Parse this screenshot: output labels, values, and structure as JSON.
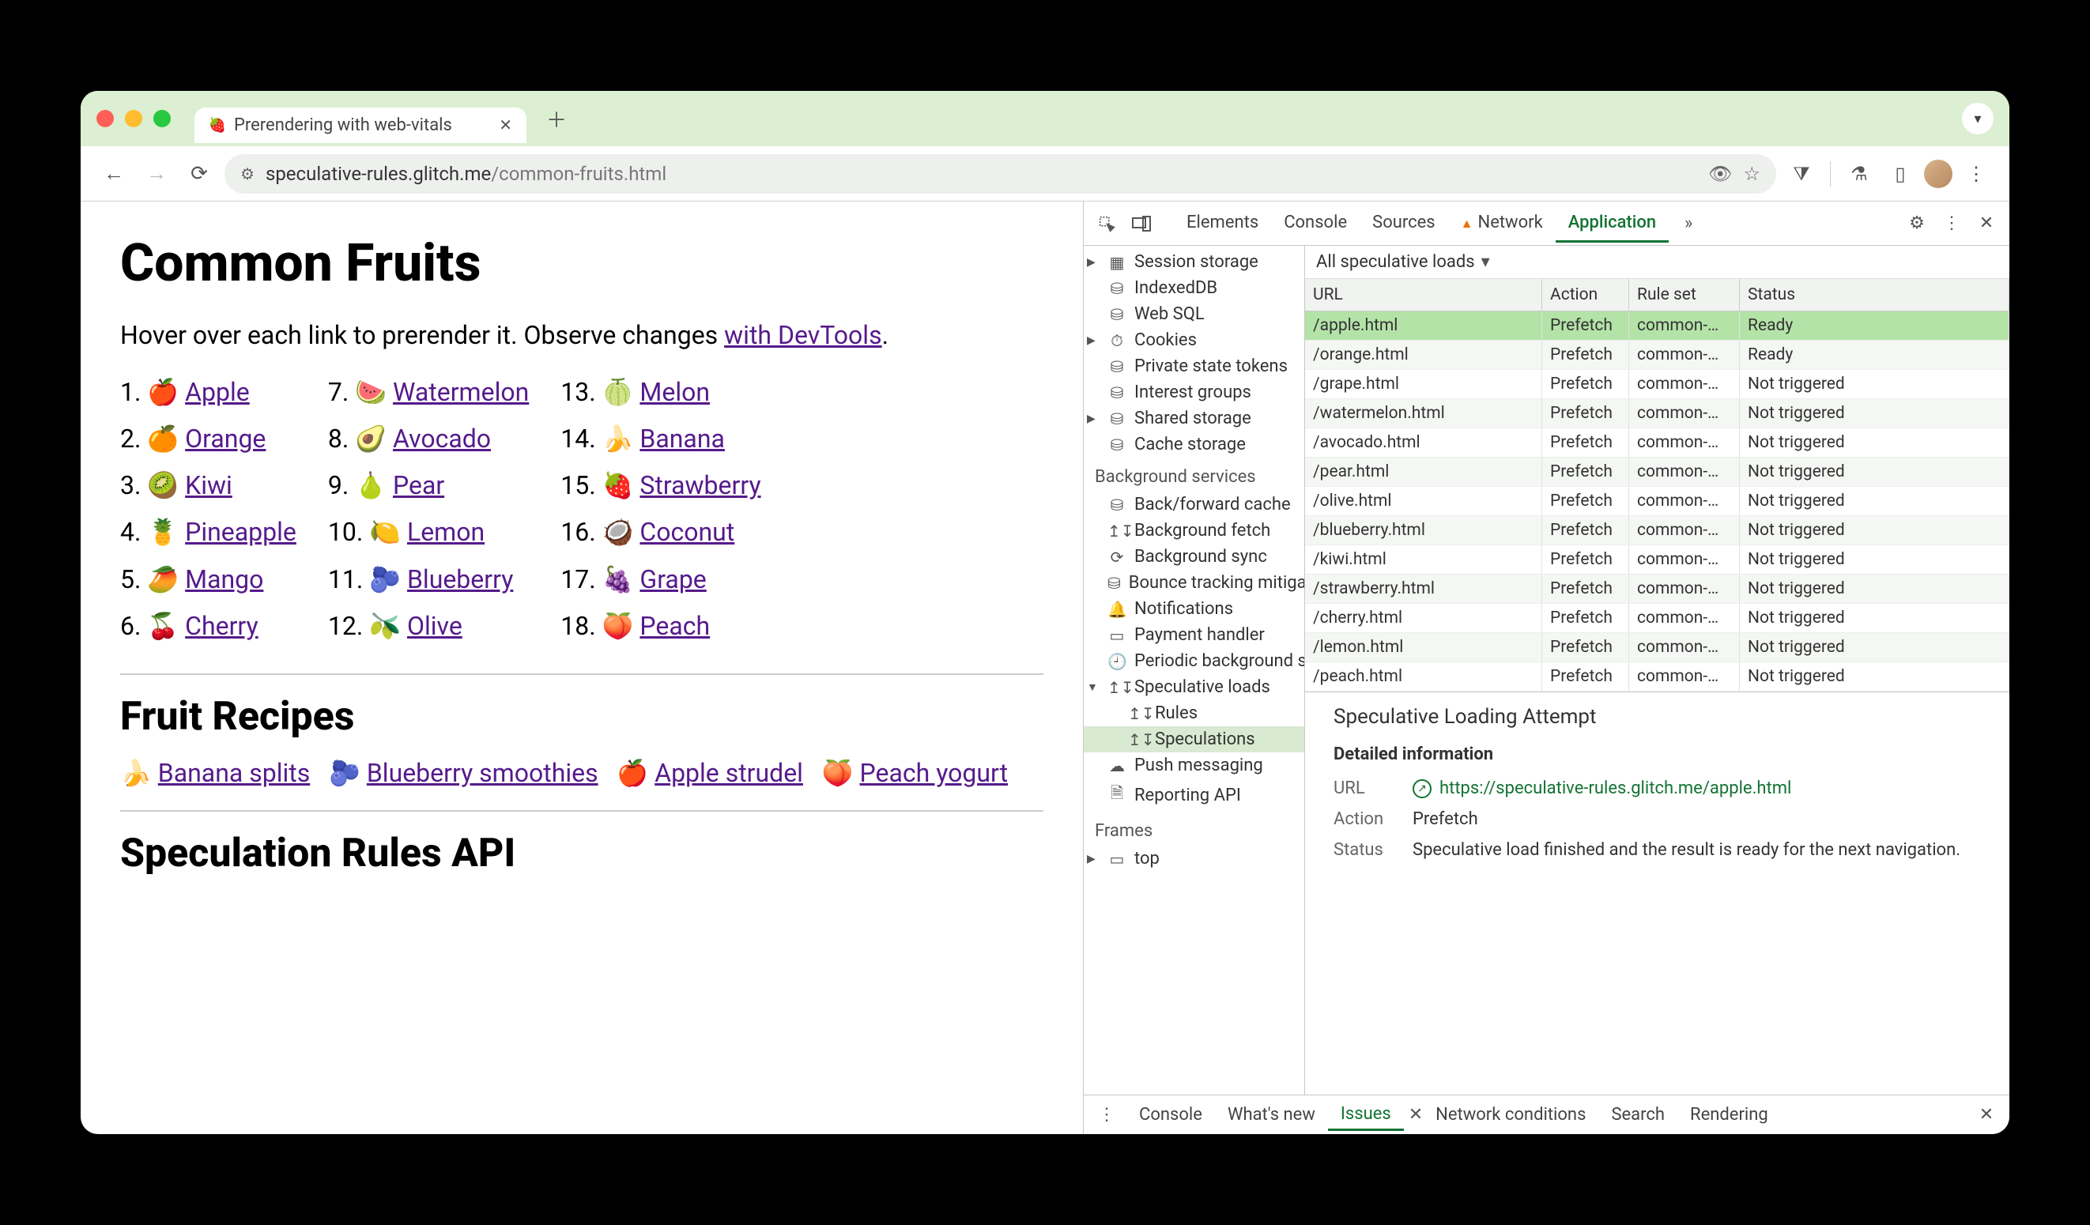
{
  "browser": {
    "tab_title": "Prerendering with web-vitals",
    "url_host": "speculative-rules.glitch.me",
    "url_path": "/common-fruits.html"
  },
  "page": {
    "h1": "Common Fruits",
    "intro_a": "Hover over each link to prerender it. Observe changes ",
    "intro_link": "with DevTools",
    "intro_b": ".",
    "fruits": [
      {
        "n": "1.",
        "e": "🍎",
        "t": "Apple"
      },
      {
        "n": "2.",
        "e": "🍊",
        "t": "Orange"
      },
      {
        "n": "3.",
        "e": "🥝",
        "t": "Kiwi"
      },
      {
        "n": "4.",
        "e": "🍍",
        "t": "Pineapple"
      },
      {
        "n": "5.",
        "e": "🥭",
        "t": "Mango"
      },
      {
        "n": "6.",
        "e": "🍒",
        "t": "Cherry"
      },
      {
        "n": "7.",
        "e": "🍉",
        "t": "Watermelon"
      },
      {
        "n": "8.",
        "e": "🥑",
        "t": "Avocado"
      },
      {
        "n": "9.",
        "e": "🍐",
        "t": "Pear"
      },
      {
        "n": "10.",
        "e": "🍋",
        "t": "Lemon"
      },
      {
        "n": "11.",
        "e": "🫐",
        "t": "Blueberry"
      },
      {
        "n": "12.",
        "e": "🫒",
        "t": "Olive"
      },
      {
        "n": "13.",
        "e": "🍈",
        "t": "Melon"
      },
      {
        "n": "14.",
        "e": "🍌",
        "t": "Banana"
      },
      {
        "n": "15.",
        "e": "🍓",
        "t": "Strawberry"
      },
      {
        "n": "16.",
        "e": "🥥",
        "t": "Coconut"
      },
      {
        "n": "17.",
        "e": "🍇",
        "t": "Grape"
      },
      {
        "n": "18.",
        "e": "🍑",
        "t": "Peach"
      }
    ],
    "h2_recipes": "Fruit Recipes",
    "recipes": [
      {
        "e": "🍌",
        "t": "Banana splits"
      },
      {
        "e": "🫐",
        "t": "Blueberry smoothies"
      },
      {
        "e": "🍎",
        "t": "Apple strudel"
      },
      {
        "e": "🍑",
        "t": "Peach yogurt"
      }
    ],
    "h2_spec": "Speculation Rules API"
  },
  "devtools": {
    "tabs": [
      "Elements",
      "Console",
      "Sources",
      "Network",
      "Application"
    ],
    "sidebar": {
      "storage": [
        {
          "i": "▦",
          "t": "Session storage",
          "tri": true
        },
        {
          "i": "⛁",
          "t": "IndexedDB"
        },
        {
          "i": "⛁",
          "t": "Web SQL"
        },
        {
          "i": "⏱",
          "t": "Cookies",
          "tri": true
        },
        {
          "i": "⛁",
          "t": "Private state tokens"
        },
        {
          "i": "⛁",
          "t": "Interest groups"
        },
        {
          "i": "⛁",
          "t": "Shared storage",
          "tri": true
        },
        {
          "i": "⛁",
          "t": "Cache storage"
        }
      ],
      "bg_label": "Background services",
      "bg": [
        {
          "i": "⛁",
          "t": "Back/forward cache"
        },
        {
          "i": "↥↧",
          "t": "Background fetch"
        },
        {
          "i": "⟳",
          "t": "Background sync"
        },
        {
          "i": "⛁",
          "t": "Bounce tracking mitigations"
        },
        {
          "i": "🔔",
          "t": "Notifications"
        },
        {
          "i": "▭",
          "t": "Payment handler"
        },
        {
          "i": "🕘",
          "t": "Periodic background sync"
        },
        {
          "i": "↥↧",
          "t": "Speculative loads",
          "tri": true,
          "open": true
        },
        {
          "i": "↥↧",
          "t": "Rules",
          "indent": true
        },
        {
          "i": "↥↧",
          "t": "Speculations",
          "indent": true,
          "selected": true
        },
        {
          "i": "☁",
          "t": "Push messaging"
        },
        {
          "i": "🗎",
          "t": "Reporting API"
        }
      ],
      "frames_label": "Frames",
      "frames": [
        {
          "i": "▭",
          "t": "top",
          "tri": true
        }
      ]
    },
    "filter": "All speculative loads",
    "columns": {
      "url": "URL",
      "action": "Action",
      "ruleset": "Rule set",
      "status": "Status"
    },
    "rows": [
      {
        "url": "/apple.html",
        "action": "Prefetch",
        "ruleset": "common-…",
        "status": "Ready",
        "sel": true
      },
      {
        "url": "/orange.html",
        "action": "Prefetch",
        "ruleset": "common-…",
        "status": "Ready"
      },
      {
        "url": "/grape.html",
        "action": "Prefetch",
        "ruleset": "common-…",
        "status": "Not triggered"
      },
      {
        "url": "/watermelon.html",
        "action": "Prefetch",
        "ruleset": "common-…",
        "status": "Not triggered"
      },
      {
        "url": "/avocado.html",
        "action": "Prefetch",
        "ruleset": "common-…",
        "status": "Not triggered"
      },
      {
        "url": "/pear.html",
        "action": "Prefetch",
        "ruleset": "common-…",
        "status": "Not triggered"
      },
      {
        "url": "/olive.html",
        "action": "Prefetch",
        "ruleset": "common-…",
        "status": "Not triggered"
      },
      {
        "url": "/blueberry.html",
        "action": "Prefetch",
        "ruleset": "common-…",
        "status": "Not triggered"
      },
      {
        "url": "/kiwi.html",
        "action": "Prefetch",
        "ruleset": "common-…",
        "status": "Not triggered"
      },
      {
        "url": "/strawberry.html",
        "action": "Prefetch",
        "ruleset": "common-…",
        "status": "Not triggered"
      },
      {
        "url": "/cherry.html",
        "action": "Prefetch",
        "ruleset": "common-…",
        "status": "Not triggered"
      },
      {
        "url": "/lemon.html",
        "action": "Prefetch",
        "ruleset": "common-…",
        "status": "Not triggered"
      },
      {
        "url": "/peach.html",
        "action": "Prefetch",
        "ruleset": "common-…",
        "status": "Not triggered"
      }
    ],
    "detail": {
      "title": "Speculative Loading Attempt",
      "subtitle": "Detailed information",
      "url_k": "URL",
      "url_v": "https://speculative-rules.glitch.me/apple.html",
      "action_k": "Action",
      "action_v": "Prefetch",
      "status_k": "Status",
      "status_v": "Speculative load finished and the result is ready for the next navigation."
    },
    "drawer": [
      "Console",
      "What's new",
      "Issues",
      "Network conditions",
      "Search",
      "Rendering"
    ]
  }
}
